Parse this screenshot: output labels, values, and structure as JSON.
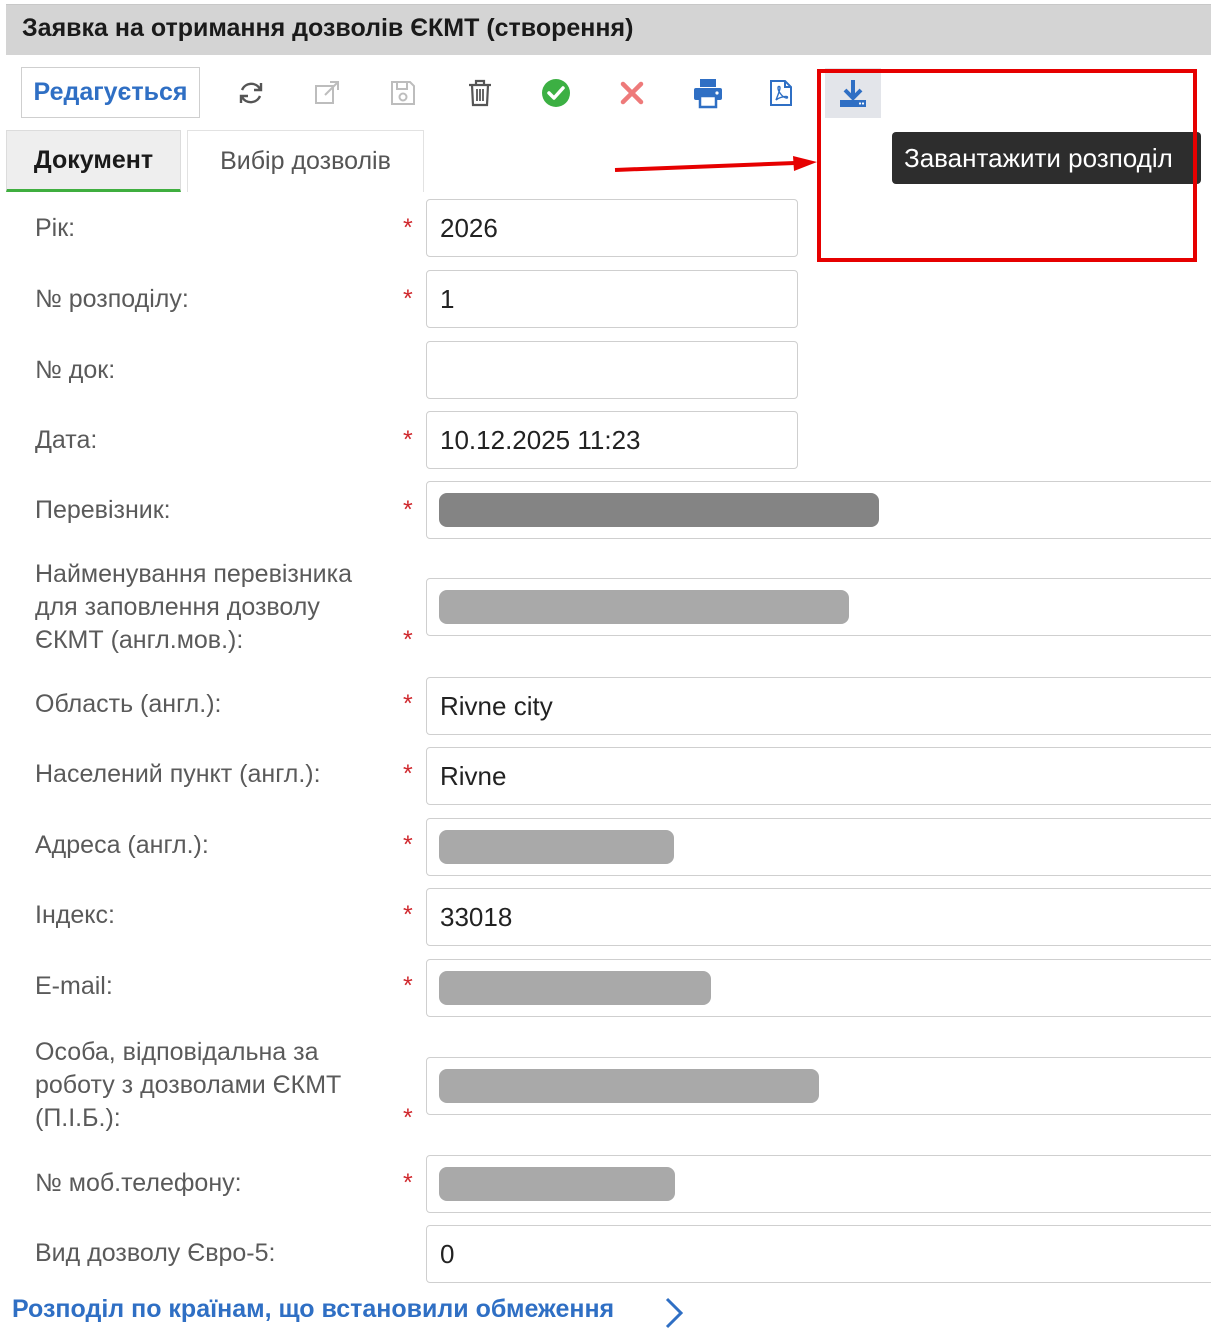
{
  "window": {
    "title": "Заявка на отримання дозволів ЄКМТ (створення)"
  },
  "toolbar": {
    "mode_label": "Редагується",
    "buttons": [
      {
        "icon": "refresh-icon",
        "enabled": true
      },
      {
        "icon": "external-link-icon",
        "enabled": false
      },
      {
        "icon": "save-icon",
        "enabled": false
      },
      {
        "icon": "trash-icon",
        "enabled": true
      },
      {
        "icon": "check-circle-icon",
        "enabled": true
      },
      {
        "icon": "cancel-x-icon",
        "enabled": true
      },
      {
        "icon": "printer-icon",
        "enabled": true
      },
      {
        "icon": "pdf-icon",
        "enabled": true
      },
      {
        "icon": "download-icon",
        "enabled": true
      }
    ],
    "tooltip": "Завантажити розподіл"
  },
  "tabs": [
    {
      "label": "Документ",
      "active": true
    },
    {
      "label": "Вибір дозволів",
      "active": false
    }
  ],
  "form": {
    "year": {
      "label": "Рік:",
      "value": "2026",
      "required": true
    },
    "distribution_no": {
      "label": "№ розподілу:",
      "value": "1",
      "required": true
    },
    "doc_no": {
      "label": "№ док:",
      "value": "",
      "required": false
    },
    "date": {
      "label": "Дата:",
      "value": "10.12.2025 11:23",
      "required": true
    },
    "carrier": {
      "label": "Перевізник:",
      "value": "",
      "required": true
    },
    "carrier_name_en": {
      "label_lines": [
        "Найменування перевізника",
        "для заповлення дозволу",
        "ЄКМТ (англ.мов.):"
      ],
      "value": "",
      "required": true
    },
    "region_en": {
      "label": "Область (англ.):",
      "value": "Rivne city",
      "required": true
    },
    "settlement_en": {
      "label": "Населений пункт (англ.):",
      "value": "Rivne",
      "required": true
    },
    "address_en": {
      "label": "Адреса (англ.):",
      "value": "",
      "required": true
    },
    "postal_index": {
      "label": "Індекс:",
      "value": "33018",
      "required": true
    },
    "email": {
      "label": "E-mail:",
      "value": "",
      "required": true
    },
    "responsible_person": {
      "label_lines": [
        "Особа, відповідальна за",
        "роботу з дозволами ЄКМТ",
        "(П.І.Б.):"
      ],
      "value": "",
      "required": true
    },
    "mobile_phone": {
      "label": "№ моб.телефону:",
      "value": "",
      "required": true
    },
    "euro5_permit_type": {
      "label": "Вид дозволу Євро-5:",
      "value": "0",
      "required": false
    }
  },
  "footer": {
    "link_label": "Розподіл по країнам, що встановили обмеження"
  },
  "colors": {
    "accent_blue": "#2f6fc4",
    "required_red": "#d0282d",
    "annotation_red": "#e60000",
    "tab_active_green": "#3fae3f"
  }
}
